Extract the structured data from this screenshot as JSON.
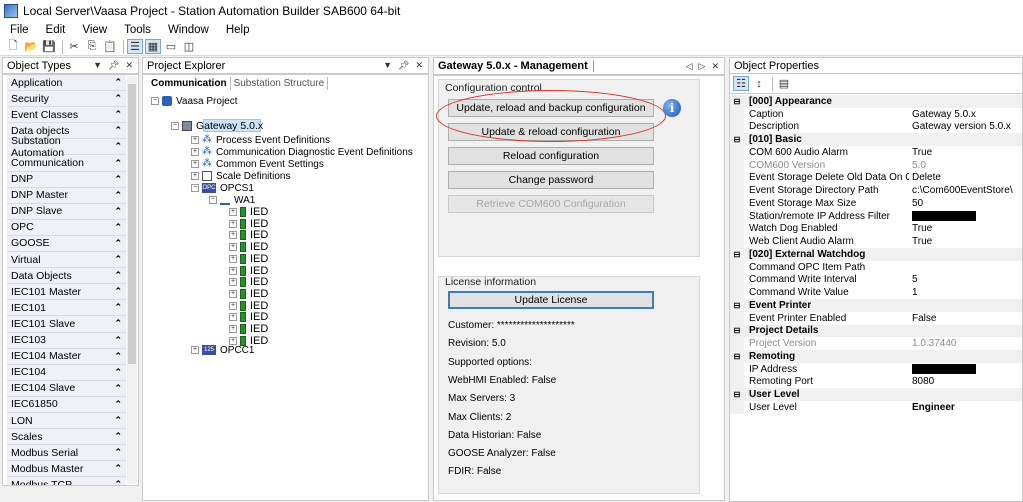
{
  "window": {
    "title": "Local Server\\Vaasa Project - Station Automation Builder SAB600 64-bit"
  },
  "menu": [
    "File",
    "Edit",
    "View",
    "Tools",
    "Window",
    "Help"
  ],
  "object_types": {
    "title": "Object Types",
    "items": [
      "Application",
      "Security",
      "Event Classes",
      "Data objects",
      "Substation Automation",
      "Communication",
      "DNP",
      "DNP Master",
      "DNP Slave",
      "OPC",
      "GOOSE",
      "Virtual",
      "Data Objects",
      "IEC101 Master",
      "IEC101",
      "IEC101 Slave",
      "IEC103",
      "IEC104 Master",
      "IEC104",
      "IEC104 Slave",
      "IEC61850",
      "LON",
      "Scales",
      "Modbus Serial",
      "Modbus Master",
      "Modbus TCP"
    ]
  },
  "project_explorer": {
    "title": "Project Explorer",
    "tabs": [
      "Communication",
      "Substation Structure"
    ],
    "root": "Vaasa Project",
    "gateway": "Gateway 5.0.x",
    "children": [
      "Process Event Definitions",
      "Communication Diagnostic Event Definitions",
      "Common Event Settings",
      "Scale Definitions"
    ],
    "opcs": "OPCS1",
    "wa": "WA1",
    "ied_label": "IED",
    "ied_count": 12,
    "opcc": "OPCC1"
  },
  "gateway_management": {
    "tab_title": "Gateway 5.0.x - Management",
    "config_group": "Configuration control",
    "buttons": {
      "update_reload_backup": "Update, reload and backup configuration",
      "update_reload": "Update & reload configuration",
      "reload": "Reload configuration",
      "change_password": "Change password",
      "retrieve": "Retrieve COM600 Configuration"
    },
    "license_group": "License information",
    "update_license": "Update License",
    "license_lines": [
      "Customer: ********************",
      "Revision: 5.0",
      "Supported options:",
      "WebHMI Enabled: False",
      "Max Servers: 3",
      "Max Clients: 2",
      "Data Historian: False",
      "GOOSE Analyzer: False",
      "FDIR: False"
    ]
  },
  "object_properties": {
    "title": "Object Properties",
    "rows": [
      {
        "cat": true,
        "name": "[000] Appearance"
      },
      {
        "name": "Caption",
        "value": "Gateway 5.0.x"
      },
      {
        "name": "Description",
        "value": "Gateway version 5.0.x"
      },
      {
        "cat": true,
        "name": "[010] Basic"
      },
      {
        "name": "COM 600 Audio Alarm",
        "value": "True"
      },
      {
        "name": "COM600 Version",
        "value": "5.0",
        "grey": true
      },
      {
        "name": "Event Storage Delete Old Data On Overflow",
        "value": "Delete"
      },
      {
        "name": "Event Storage Directory Path",
        "value": "c:\\Com600EventStore\\"
      },
      {
        "name": "Event Storage Max Size",
        "value": "50"
      },
      {
        "name": "Station/remote IP Address Filter",
        "value": "",
        "redacted": true
      },
      {
        "name": "Watch Dog Enabled",
        "value": "True"
      },
      {
        "name": "Web Client Audio Alarm",
        "value": "True"
      },
      {
        "cat": true,
        "name": "[020] External Watchdog"
      },
      {
        "name": "Command OPC Item Path",
        "value": ""
      },
      {
        "name": "Command Write Interval",
        "value": "5"
      },
      {
        "name": "Command Write Value",
        "value": "1"
      },
      {
        "cat": true,
        "name": "Event Printer"
      },
      {
        "name": "Event Printer Enabled",
        "value": "False"
      },
      {
        "cat": true,
        "name": "Project Details"
      },
      {
        "name": "Project Version",
        "value": "1.0.37440",
        "grey": true
      },
      {
        "cat": true,
        "name": "Remoting"
      },
      {
        "name": "IP Address",
        "value": "",
        "redacted": true
      },
      {
        "name": "Remoting Port",
        "value": "8080"
      },
      {
        "cat": true,
        "name": "User Level"
      },
      {
        "name": "User Level",
        "value": "Engineer",
        "bold": true
      }
    ]
  },
  "colors": {
    "highlight_ellipse": "#d9332c",
    "selection": "#cce4f7"
  }
}
